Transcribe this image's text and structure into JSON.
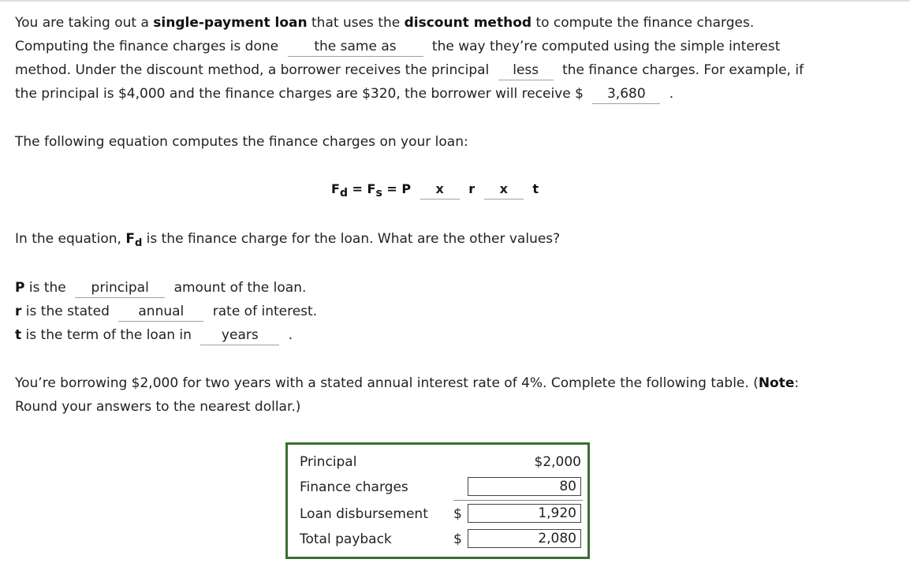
{
  "intro": {
    "t1": "You are taking out a ",
    "b1": "single-payment loan",
    "t2": " that uses the ",
    "b2": "discount method",
    "t3": " to compute the finance charges.",
    "t4": "Computing the finance charges is done",
    "blank1": "the same as",
    "t5": "the way they’re computed using the simple interest",
    "t6": "method. Under the discount method, a borrower receives the principal",
    "blank2": "less",
    "t7": "the finance charges. For example, if",
    "t8": "the principal is $4,000 and the finance charges are $320, the borrower will receive $",
    "blank3": "3,680",
    "t9": "."
  },
  "equation_intro": "The following equation computes the finance charges on your loan:",
  "equation": {
    "fd": "F",
    "fd_sub": "d",
    "eq1": "=",
    "fs": "F",
    "fs_sub": "s",
    "eq2": "=",
    "p": "P",
    "op1": "x",
    "r": "r",
    "op2": "x",
    "t": "t"
  },
  "question": {
    "t1": "In the equation, ",
    "fd": "F",
    "fd_sub": "d",
    "t2": " is the finance charge for the loan. What are the other values?"
  },
  "definitions": [
    {
      "var": "P",
      "pre": " is the",
      "blank": "principal",
      "post": "amount of the loan."
    },
    {
      "var": "r",
      "pre": " is the stated",
      "blank": "annual",
      "post": "rate of interest."
    },
    {
      "var": "t",
      "pre": " is the term of the loan in",
      "blank": "years",
      "post": "."
    }
  ],
  "problem": {
    "t1": "You’re borrowing $2,000 for two years with a stated annual interest rate of 4%. Complete the following table. (",
    "note": "Note",
    "t2": ":",
    "t3": "Round your answers to the nearest dollar.)"
  },
  "table": {
    "rows": [
      {
        "label": "Principal",
        "dollar": "",
        "value": "$2,000"
      },
      {
        "label": "Finance charges",
        "dollar": "",
        "value": "80"
      },
      {
        "label": "Loan disbursement",
        "dollar": "$",
        "value": "1,920"
      },
      {
        "label": "Total payback",
        "dollar": "$",
        "value": "2,080"
      }
    ],
    "border_color": "#3c6e32"
  }
}
